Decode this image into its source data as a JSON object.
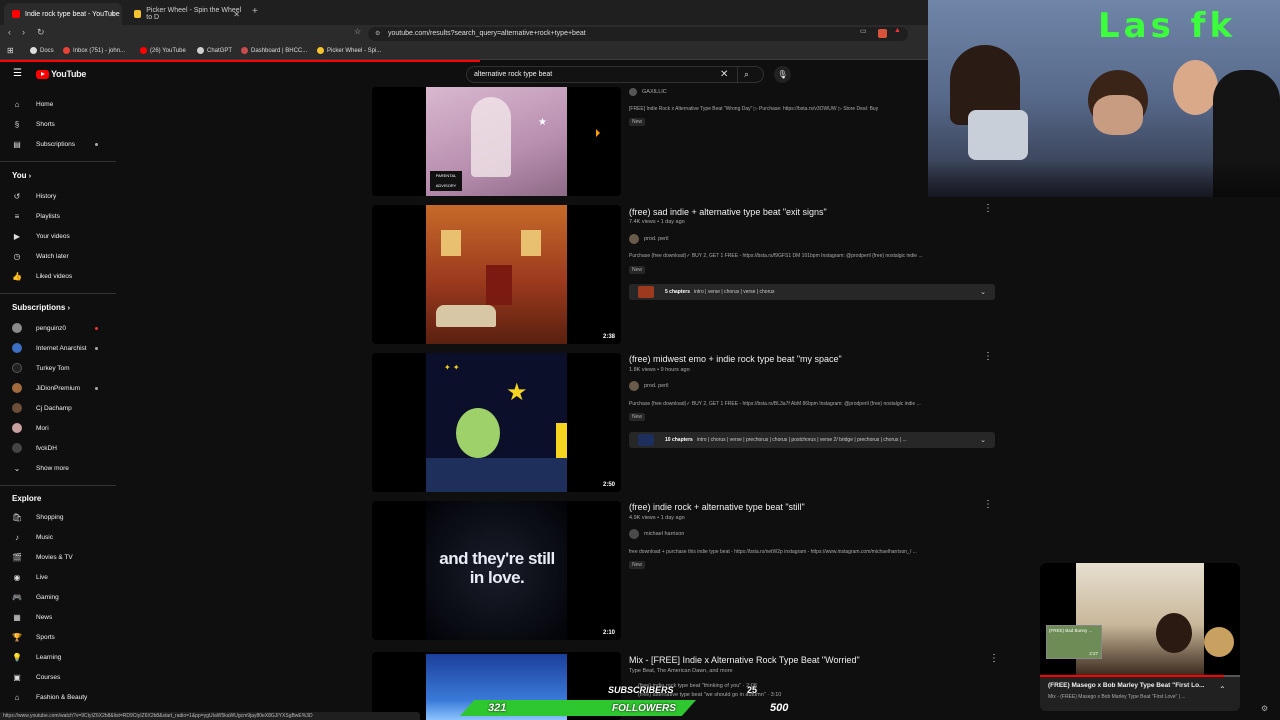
{
  "browser": {
    "tabs": [
      {
        "label": "Indie rock type beat - YouTube",
        "active": true
      },
      {
        "label": "Picker Wheel - Spin the Wheel to D",
        "active": false
      }
    ],
    "url": "youtube.com/results?search_query=alternative+rock+type+beat",
    "bookmarks": [
      "Docs",
      "Inbox (751) - john...",
      "(26) YouTube",
      "ChatGPT",
      "Dashboard | BHCC...",
      "Picker Wheel - Spi..."
    ],
    "status_url": "https://www.youtube.com/watch?v=9CtyIZ6X2b8&list=RD9CtyIZ6X2b8&start_radio=1&pp=ygUIaW5kaWUgcm9jay80eX8GJIYXSgBwE%3D"
  },
  "youtube": {
    "logo": "YouTube",
    "search_query": "alternative rock type beat",
    "sidebar": {
      "main": [
        "Home",
        "Shorts",
        "Subscriptions"
      ],
      "you_header": "You",
      "you_items": [
        "History",
        "Playlists",
        "Your videos",
        "Watch later",
        "Liked videos"
      ],
      "subs_header": "Subscriptions",
      "subs": [
        "penguinz0",
        "Internet Anarchist",
        "Turkey Tom",
        "JiDionPremium",
        "Cj Dachamp",
        "Mori",
        "fvckDH"
      ],
      "show_more": "Show more",
      "explore_header": "Explore",
      "explore": [
        "Shopping",
        "Music",
        "Movies & TV",
        "Live",
        "Gaming",
        "News",
        "Sports",
        "Learning",
        "Courses",
        "Fashion & Beauty"
      ]
    },
    "results": [
      {
        "channel": "GAXILLIC",
        "description": "[FREE] Indie Rock x Alternative Type Beat \"Wrong Day\" ▷ Purchase: https://bsta.rs/v3OWUW ▷ Store Deal: Buy",
        "badge": "New"
      },
      {
        "title": "(free) sad indie + alternative type beat \"exit signs\"",
        "meta": "7.4K views • 1 day ago",
        "channel": "prod. peril",
        "description": "Purchase (free download)✓ BUY 2, GET 1 FREE - https://bsta.rs/f9GFS1 DM 101bpm Instagram: @prodperil (free) nostalgic indie ...",
        "badge": "New",
        "chapters_count": "5 chapters",
        "chapters": "intro | verse | chorus | verse | chorus",
        "duration": "2:38"
      },
      {
        "title": "(free) midwest emo + indie rock type beat \"my space\"",
        "meta": "1.8K views • 9 hours ago",
        "channel": "prod. peril",
        "description": "Purchase (free download)✓ BUY 2, GET 1 FREE - https://bsta.rs/BL3a7f AbM 86bpm Instagram: @prodperil (free) nostalgic indie ...",
        "badge": "New",
        "chapters_count": "10 chapters",
        "chapters": "intro | chorus | verse | prechorus | chorus | postchorus | verse 2/ bridge | prechorus | chorus | ...",
        "duration": "2:50"
      },
      {
        "title": "(free) indie rock + alternative type beat \"still\"",
        "meta": "4.9K views • 1 day ago",
        "channel": "michael harrison",
        "description": "free download + purchase this indie type beat - https://bsta.rs/netW2p instagram - https://www.instagram.com/michaelharrison_/ ...",
        "badge": "New",
        "duration": "2:10",
        "thumb_text": "and they're still in love."
      },
      {
        "title": "Mix - [FREE] Indie x Alternative Rock Type Beat \"Worried\"",
        "channel": "Type Beat, The American Dawn, and more",
        "sub1": "(free) indie rock type beat \"thinking of you\" · 2:08",
        "sub2": "(free) alternative type beat \"we should go in autumn\" · 3:10"
      }
    ],
    "miniplayer": {
      "title": "(FREE) Masego x Bob Marley Type Beat \"First Lo...",
      "subtitle": "Mix - (FREE) Masego x Bob Marley Type Beat \"First Love\" | ...",
      "inner_label": "(FREE) Bad Bunny ...",
      "inner_duration": "2:27"
    }
  },
  "stream_overlay": {
    "subscribers_label": "SUBSCRIBERS",
    "subscribers_count": "25",
    "followers_label": "FOLLOWERS",
    "followers_count": "321",
    "goal": "500",
    "cam_text": "Las fk"
  },
  "colors": {
    "youtube_red": "#ff0000",
    "overlay_green": "#2fc72f",
    "bg": "#0f0f0f"
  }
}
